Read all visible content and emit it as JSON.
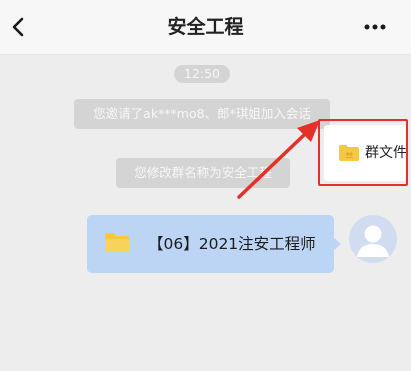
{
  "header": {
    "title": "安全工程"
  },
  "chat": {
    "timestamp": "12:50",
    "system_messages": {
      "invite": "您邀请了ak***mo8、郎*琪姐加入会话",
      "rename": "您修改群名称为安全工程"
    },
    "file_message": {
      "name": "【06】2021注安工程师"
    }
  },
  "group_files_button": {
    "label": "群文件"
  },
  "colors": {
    "bubble": "#bcd5f5",
    "folder": "#f5c842",
    "annotation": "#e53027"
  }
}
